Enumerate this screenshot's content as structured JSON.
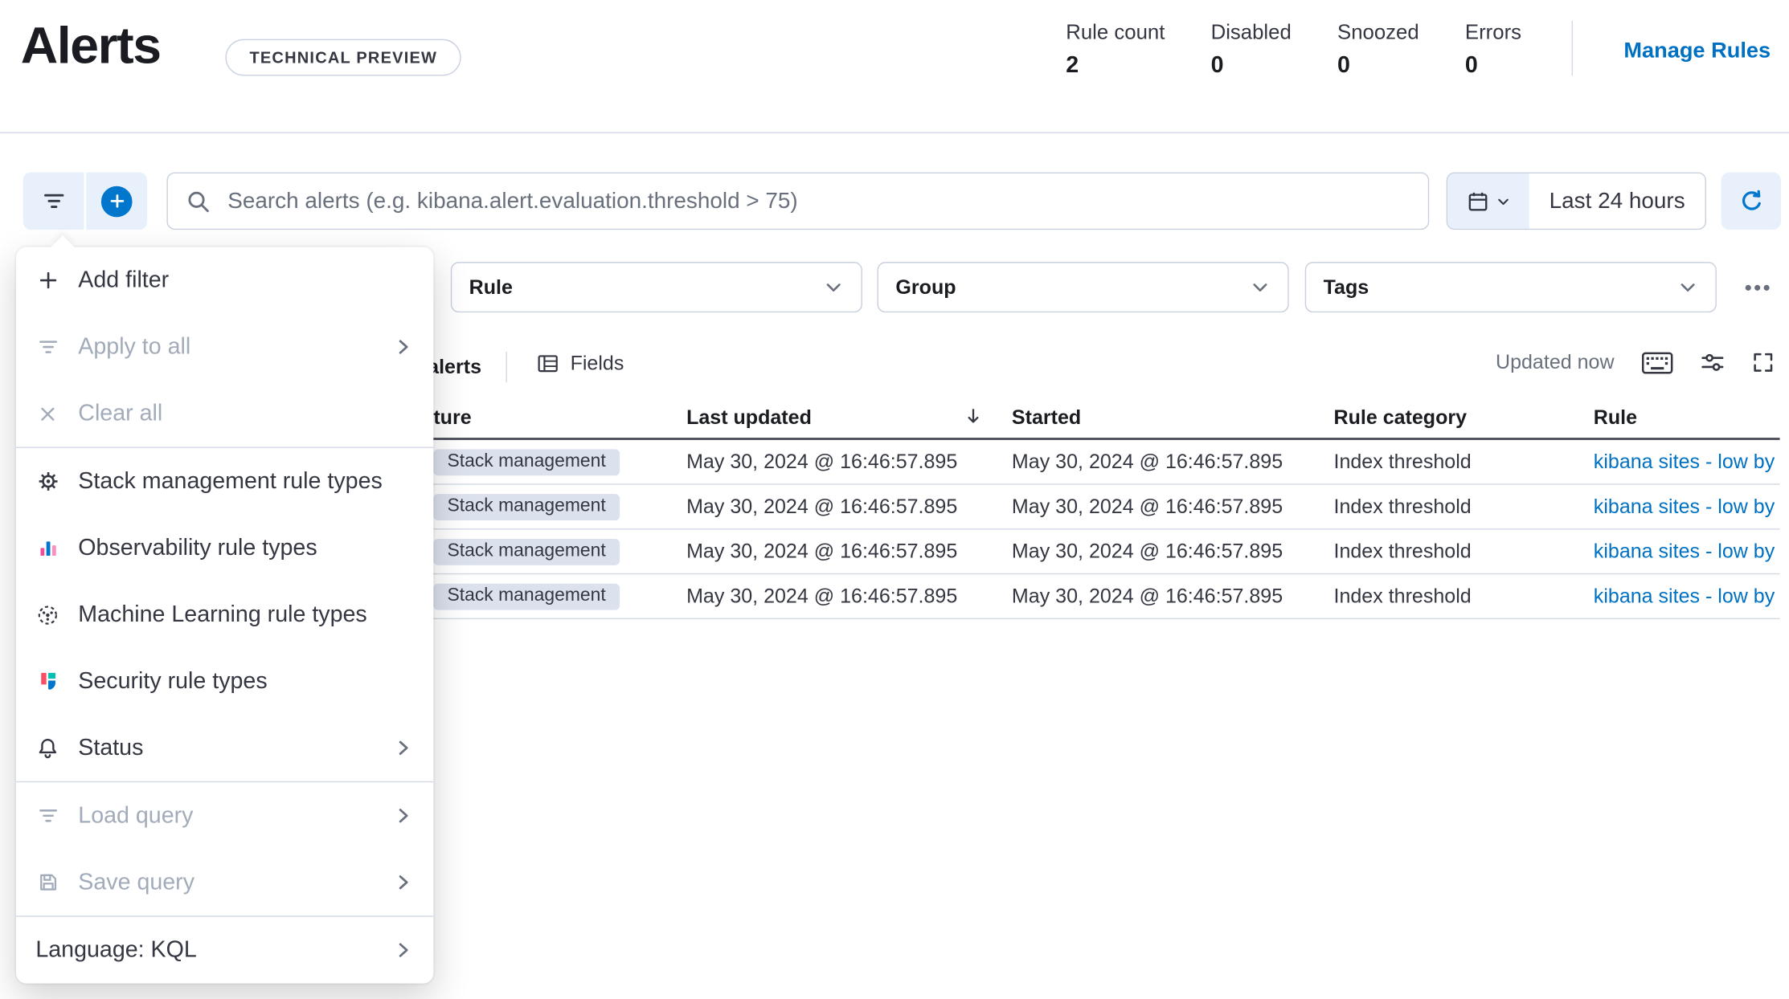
{
  "header": {
    "title": "Alerts",
    "tech_preview_badge": "TECHNICAL PREVIEW",
    "stats": [
      {
        "label": "Rule count",
        "value": "2"
      },
      {
        "label": "Disabled",
        "value": "0"
      },
      {
        "label": "Snoozed",
        "value": "0"
      },
      {
        "label": "Errors",
        "value": "0"
      }
    ],
    "manage_rules_label": "Manage Rules"
  },
  "search_bar": {
    "placeholder": "Search alerts (e.g. kibana.alert.evaluation.threshold > 75)",
    "time_range_label": "Last 24 hours"
  },
  "filter_controls": {
    "selects": [
      {
        "label": "Rule"
      },
      {
        "label": "Group"
      },
      {
        "label": "Tags"
      }
    ]
  },
  "filter_popover": {
    "groups": [
      {
        "items": [
          {
            "label": "Add filter",
            "icon": "plus-icon",
            "disabled": false
          },
          {
            "label": "Apply to all",
            "icon": "filter-icon",
            "disabled": true,
            "chevron": true
          },
          {
            "label": "Clear all",
            "icon": "cross-icon",
            "disabled": true
          }
        ]
      },
      {
        "items": [
          {
            "label": "Stack management rule types",
            "icon": "gear-icon"
          },
          {
            "label": "Observability rule types",
            "icon": "observability-bars-icon"
          },
          {
            "label": "Machine Learning rule types",
            "icon": "machine-learning-icon"
          },
          {
            "label": "Security rule types",
            "icon": "security-logo-icon"
          },
          {
            "label": "Status",
            "icon": "bell-icon",
            "chevron": true
          }
        ]
      },
      {
        "items": [
          {
            "label": "Load query",
            "icon": "filter-icon",
            "disabled": true,
            "chevron": true
          },
          {
            "label": "Save query",
            "icon": "save-icon",
            "disabled": true,
            "chevron": true
          }
        ]
      },
      {
        "items": [
          {
            "label": "Language: KQL",
            "chevron": true
          }
        ]
      }
    ]
  },
  "toolbar": {
    "alerts_count_label": "alerts",
    "fields_label": "Fields",
    "updated_label": "Updated now"
  },
  "table": {
    "columns": {
      "feature": "ture",
      "last_updated": "Last updated",
      "started": "Started",
      "rule_category": "Rule category",
      "rule": "Rule"
    },
    "rows": [
      {
        "feature_badge": "Stack management",
        "last_updated": "May 30, 2024 @ 16:46:57.895",
        "started": "May 30, 2024 @ 16:46:57.895",
        "rule_category": "Index threshold",
        "rule": "kibana sites - low by"
      },
      {
        "feature_badge": "Stack management",
        "last_updated": "May 30, 2024 @ 16:46:57.895",
        "started": "May 30, 2024 @ 16:46:57.895",
        "rule_category": "Index threshold",
        "rule": "kibana sites - low by"
      },
      {
        "feature_badge": "Stack management",
        "last_updated": "May 30, 2024 @ 16:46:57.895",
        "started": "May 30, 2024 @ 16:46:57.895",
        "rule_category": "Index threshold",
        "rule": "kibana sites - low by"
      },
      {
        "feature_badge": "Stack management",
        "last_updated": "May 30, 2024 @ 16:46:57.895",
        "started": "May 30, 2024 @ 16:46:57.895",
        "rule_category": "Index threshold",
        "rule": "kibana sites - low by"
      }
    ]
  },
  "colors": {
    "primary_blue": "#0077cc",
    "link_blue": "#0071c2",
    "light_blue_bg": "#e7f0fb",
    "badge_bg": "#dbe1ed",
    "observability_pink": "#f04e98",
    "security_red": "#fa5066",
    "security_teal": "#00bfb3"
  }
}
